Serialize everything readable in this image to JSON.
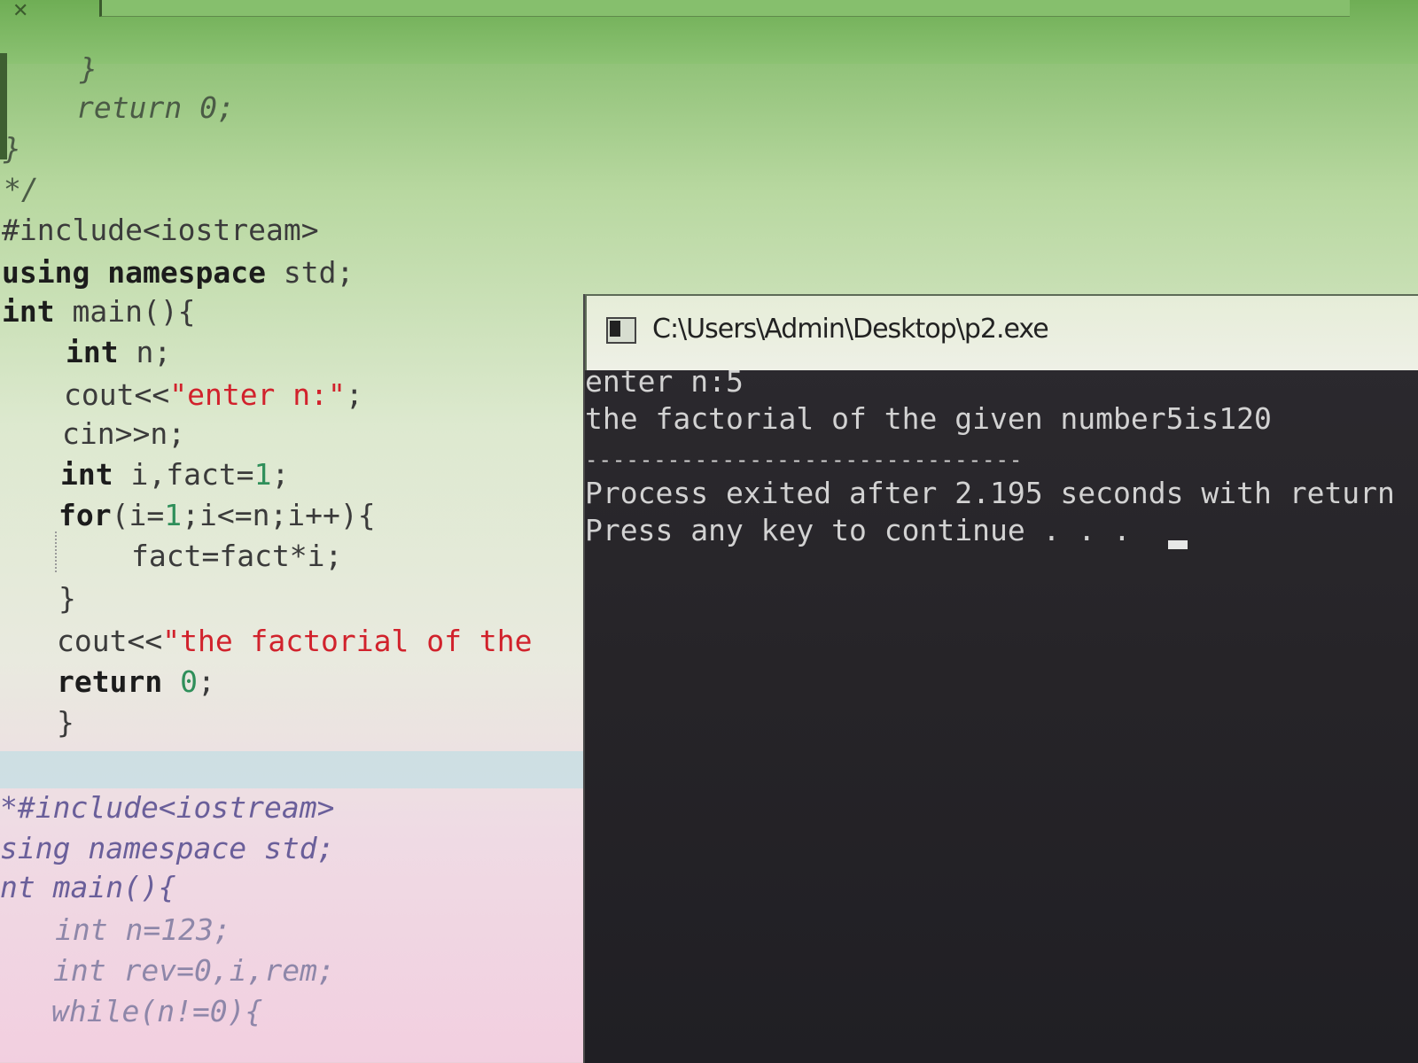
{
  "window": {
    "close_glyph": "✕"
  },
  "editor": {
    "lines": {
      "l1": "}",
      "l2": "return 0;",
      "l3": "}",
      "l4": "*/",
      "l5": "#include<iostream>",
      "l6a": "using",
      "l6b": " namespace",
      "l6c": " std;",
      "l7a": "int",
      "l7b": " main(){",
      "l8a": "int",
      "l8b": " n;",
      "l9a": "cout<<",
      "l9b": "\"enter n:\"",
      "l9c": ";",
      "l10": "cin>>n;",
      "l11a": "int",
      "l11b": " i,fact=",
      "l11c": "1",
      "l11d": ";",
      "l12a": "for",
      "l12b": "(i=",
      "l12c": "1",
      "l12d": ";i<=n;i++){",
      "l13": "fact=fact*i;",
      "l14": "}",
      "l15a": "cout<<",
      "l15b": "\"the factorial of the",
      "l16a": "return",
      "l16b": " 0",
      "l16c": ";",
      "l17": "}",
      "l18": "*#include<iostream>",
      "l19": "sing namespace std;",
      "l20": "nt main(){",
      "l21": "int n=123;",
      "l22": "int rev=0,i,rem;",
      "l23": "while(n!=0){"
    }
  },
  "console": {
    "title": "C:\\Users\\Admin\\Desktop\\p2.exe",
    "output": {
      "line1": "enter n:5",
      "line2": "the factorial of the given number5is120",
      "separator": "--------------------------------",
      "line3": "Process exited after 2.195 seconds with return",
      "line4": "Press any key to continue . . ."
    }
  }
}
